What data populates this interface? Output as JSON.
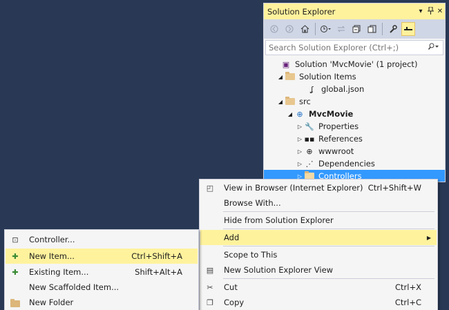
{
  "solution_explorer": {
    "title": "Solution Explorer",
    "caption_buttons": [
      "▾",
      "ᆊ",
      "✕"
    ],
    "search_placeholder": "Search Solution Explorer (Ctrl+;)",
    "tree": [
      {
        "label": "Solution 'MvcMovie' (1 project)",
        "arrow": "",
        "icon": "solution-icon",
        "glyph": "▣",
        "bold": false,
        "selected": false
      },
      {
        "label": "Solution Items",
        "arrow": "◢",
        "icon": "folder-open-icon",
        "glyph": "",
        "bold": false,
        "selected": false
      },
      {
        "label": "global.json",
        "arrow": "",
        "icon": "json-file-icon",
        "glyph": "ʆ",
        "bold": false,
        "selected": false
      },
      {
        "label": "src",
        "arrow": "◢",
        "icon": "folder-open-icon",
        "glyph": "",
        "bold": false,
        "selected": false
      },
      {
        "label": "MvcMovie",
        "arrow": "◢",
        "icon": "web-project-icon",
        "glyph": "⊕",
        "bold": true,
        "selected": false
      },
      {
        "label": "Properties",
        "arrow": "▷",
        "icon": "wrench-icon",
        "glyph": "🔧",
        "bold": false,
        "selected": false
      },
      {
        "label": "References",
        "arrow": "▷",
        "icon": "references-icon",
        "glyph": "▪▪",
        "bold": false,
        "selected": false
      },
      {
        "label": "wwwroot",
        "arrow": "▷",
        "icon": "globe-icon",
        "glyph": "⊕",
        "bold": false,
        "selected": false
      },
      {
        "label": "Dependencies",
        "arrow": "▷",
        "icon": "dependencies-icon",
        "glyph": "⋰",
        "bold": false,
        "selected": false
      },
      {
        "label": "Controllers",
        "arrow": "▷",
        "icon": "folder-icon",
        "glyph": "",
        "bold": false,
        "selected": true
      }
    ]
  },
  "context_menu": {
    "items": [
      {
        "label": "View in Browser (Internet Explorer)",
        "shortcut": "Ctrl+Shift+W",
        "icon": "browser-icon",
        "glyph": "◰",
        "highlight": false,
        "submenu": false
      },
      {
        "label": "Browse With...",
        "shortcut": "",
        "icon": "",
        "glyph": "",
        "highlight": false,
        "submenu": false
      },
      {
        "label": "Hide from Solution Explorer",
        "shortcut": "",
        "icon": "",
        "glyph": "",
        "highlight": false,
        "submenu": false
      },
      {
        "label": "Add",
        "shortcut": "",
        "icon": "",
        "glyph": "",
        "highlight": true,
        "submenu": true
      },
      {
        "label": "Scope to This",
        "shortcut": "",
        "icon": "",
        "glyph": "",
        "highlight": false,
        "submenu": false
      },
      {
        "label": "New Solution Explorer View",
        "shortcut": "",
        "icon": "new-view-icon",
        "glyph": "▤",
        "highlight": false,
        "submenu": false
      },
      {
        "label": "Cut",
        "shortcut": "Ctrl+X",
        "icon": "cut-icon",
        "glyph": "✂",
        "highlight": false,
        "submenu": false
      },
      {
        "label": "Copy",
        "shortcut": "Ctrl+C",
        "icon": "copy-icon",
        "glyph": "❐",
        "highlight": false,
        "submenu": false
      }
    ],
    "submenu_arrow": "▶"
  },
  "add_menu": {
    "items": [
      {
        "label": "Controller...",
        "shortcut": "",
        "icon": "controller-icon",
        "glyph": "⊡",
        "highlight": false
      },
      {
        "label": "New Item...",
        "shortcut": "Ctrl+Shift+A",
        "icon": "new-item-icon",
        "glyph": "✚",
        "highlight": true
      },
      {
        "label": "Existing Item...",
        "shortcut": "Shift+Alt+A",
        "icon": "existing-item-icon",
        "glyph": "✚",
        "highlight": false
      },
      {
        "label": "New Scaffolded Item...",
        "shortcut": "",
        "icon": "",
        "glyph": "",
        "highlight": false
      },
      {
        "label": "New Folder",
        "shortcut": "",
        "icon": "new-folder-icon",
        "glyph": "",
        "highlight": false
      }
    ]
  },
  "colors": {
    "background": "#293955",
    "title_bar": "#fff29d",
    "selection": "#3399ff",
    "menu_highlight": "#fff29d"
  }
}
